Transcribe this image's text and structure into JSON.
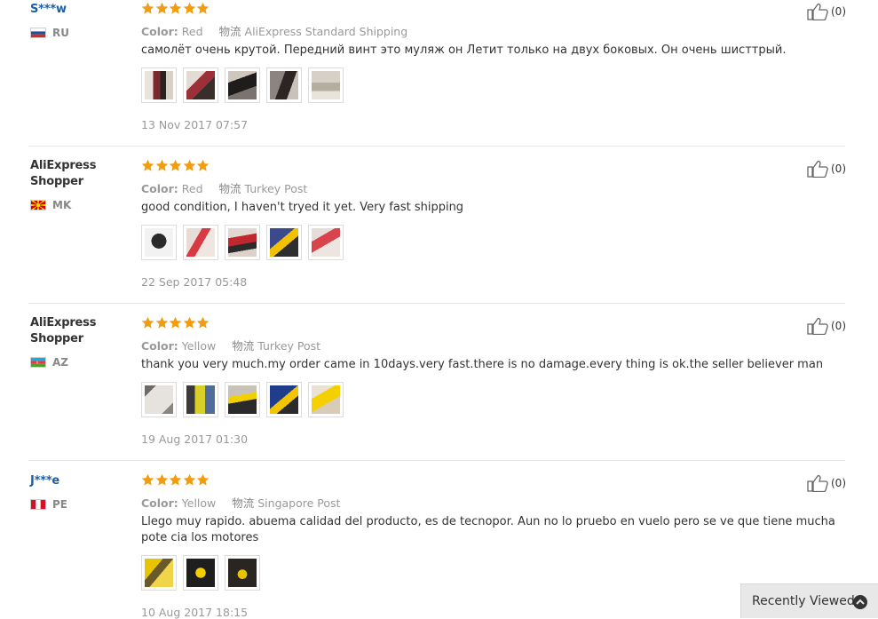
{
  "reviews": [
    {
      "user": "S***w",
      "country": "RU",
      "color_label": "Color:",
      "color": "Red",
      "ship_label": "物流",
      "shipping": "AliExpress Standard Shipping",
      "text": "самолёт очень крутой. Передний винт это муляж он Летит только на двух боковых. Он очень шисттрый.",
      "date": "13 Nov 2017 07:57",
      "likes": "(0)"
    },
    {
      "user": "AliExpress Shopper",
      "country": "MK",
      "color_label": "Color:",
      "color": "Red",
      "ship_label": "物流",
      "shipping": "Turkey Post",
      "text": "good condition, I haven't tryed it yet. Very fast shipping",
      "date": "22 Sep 2017 05:48",
      "likes": "(0)"
    },
    {
      "user": "AliExpress Shopper",
      "country": "AZ",
      "color_label": "Color:",
      "color": "Yellow",
      "ship_label": "物流",
      "shipping": "Turkey Post",
      "text": "thank you very much.my order came in 10days.very fast.there is no damage.every thing is ok.the seller believer man",
      "date": "19 Aug 2017 01:30",
      "likes": "(0)"
    },
    {
      "user": "J***e",
      "country": "PE",
      "color_label": "Color:",
      "color": "Yellow",
      "ship_label": "物流",
      "shipping": "Singapore Post",
      "text": "Llego muy rapido. abuema calidad del producto, es de tecnopor. Aun no lo pruebo en vuelo pero se ve que tiene mucha pote cia los motores",
      "date": "10 Aug 2017 18:15",
      "likes": "(0)"
    }
  ],
  "rating_stars": 5,
  "colors": {
    "star": "#f29d10",
    "link": "#1a5ea8"
  },
  "recently_viewed": {
    "label": "Recently Viewed",
    "icon": "chevron-up-icon"
  }
}
